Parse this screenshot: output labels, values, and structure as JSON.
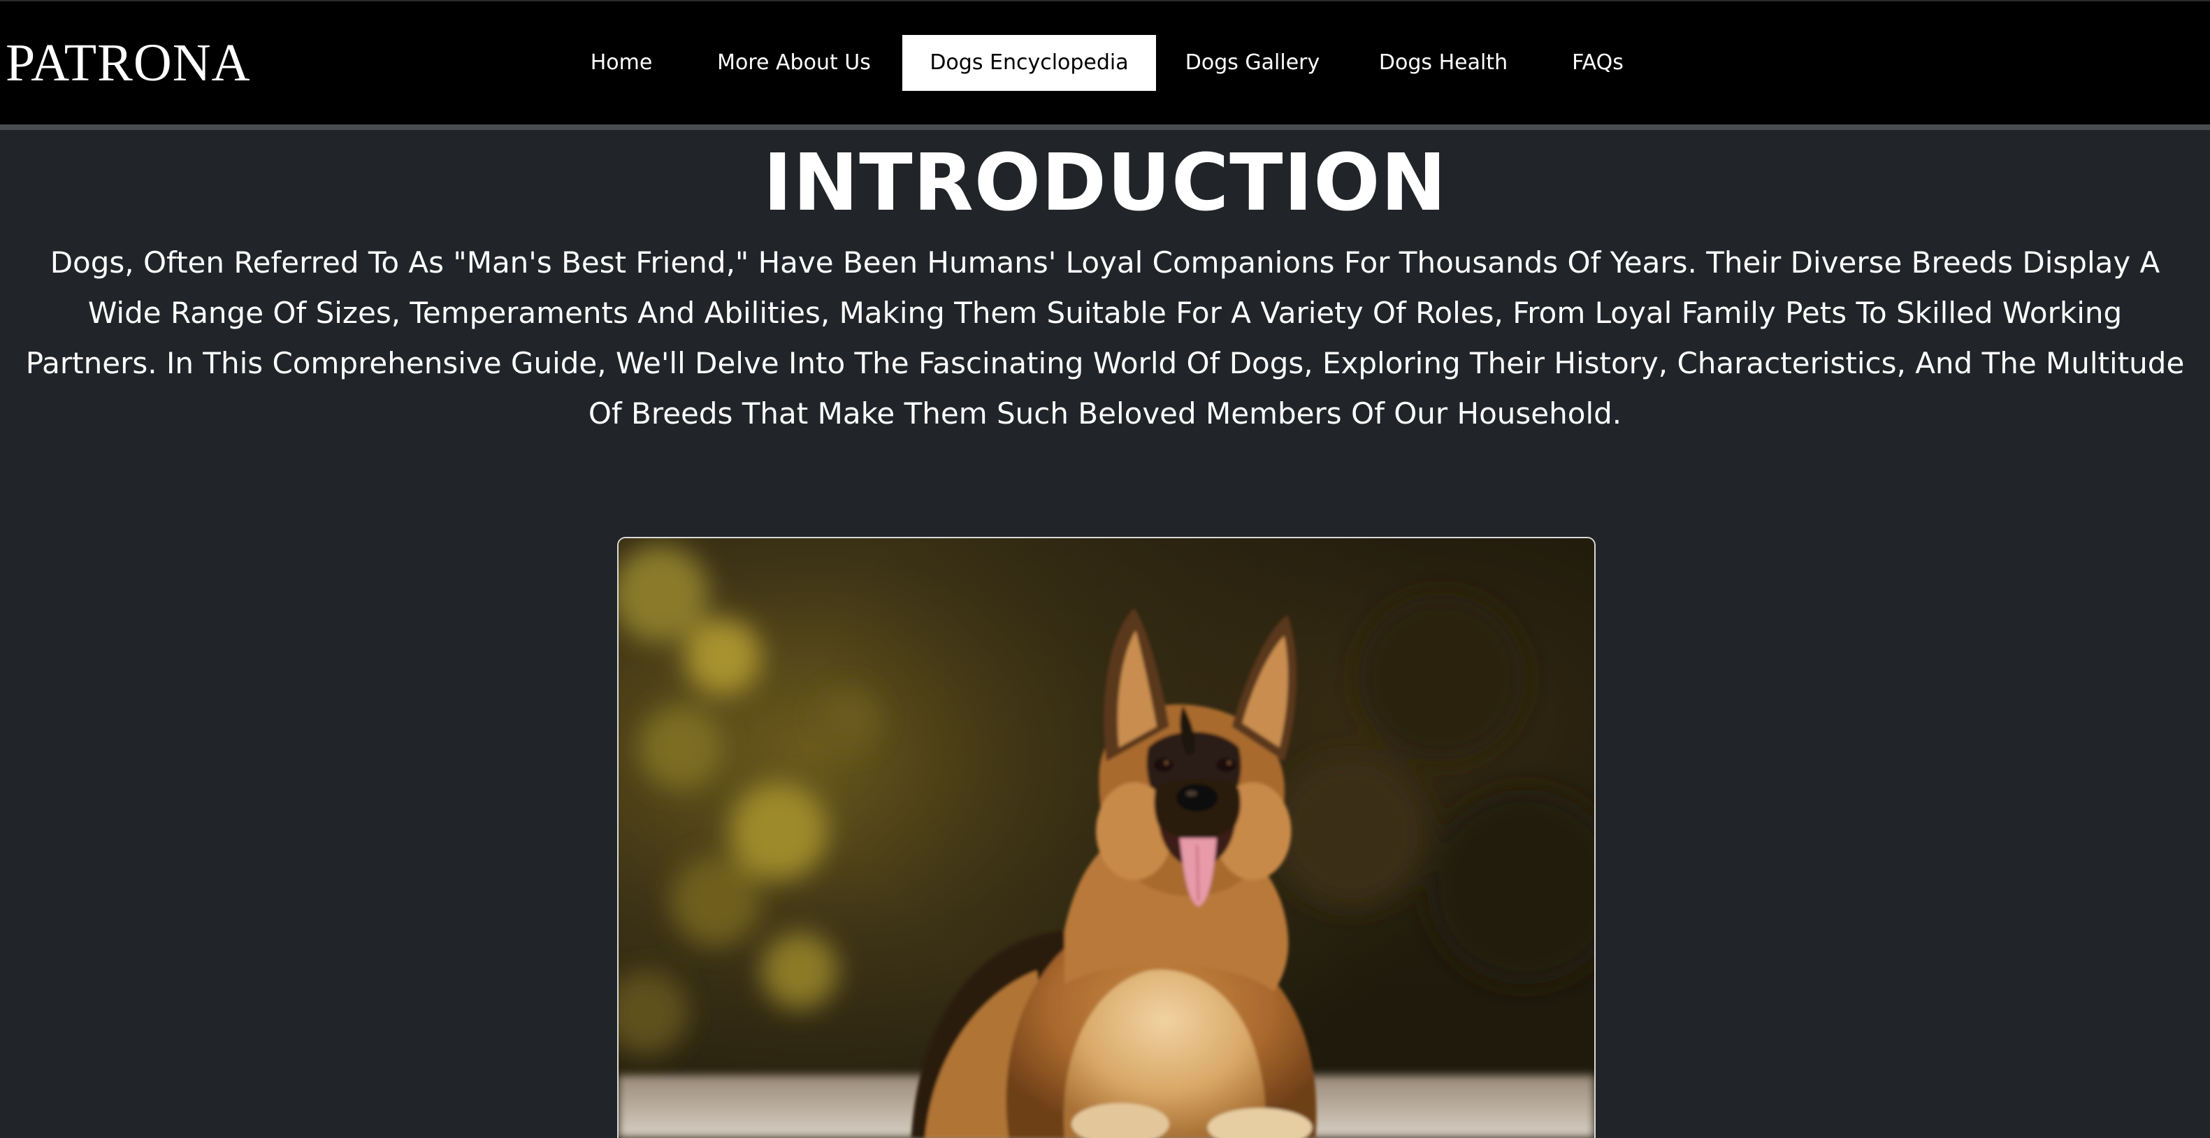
{
  "header": {
    "brand": "PATRONA"
  },
  "nav": {
    "items": [
      {
        "label": "Home"
      },
      {
        "label": "More About Us"
      },
      {
        "label": "Dogs Encyclopedia"
      },
      {
        "label": "Dogs Gallery"
      },
      {
        "label": "Dogs Health"
      },
      {
        "label": "FAQs"
      }
    ],
    "active": "Dogs Encyclopedia"
  },
  "main": {
    "title": "INTRODUCTION",
    "intro_text": "Dogs, Often Referred To As \"Man's Best Friend,\" Have Been Humans' Loyal Companions For Thousands Of Years. Their Diverse Breeds Display A Wide Range Of Sizes, Temperaments And Abilities, Making Them Suitable For A Variety Of Roles, From Loyal Family Pets To Skilled Working Partners. In This Comprehensive Guide, We'll Delve Into The Fascinating World Of Dogs, Exploring Their History, Characteristics, And The Multitude Of Breeds That Make Them Such Beloved Members Of Our Household."
  },
  "colors": {
    "page_background": "#212529",
    "navbar_background": "#000000",
    "active_tab_background": "#ffffff",
    "text": "#ffffff"
  }
}
